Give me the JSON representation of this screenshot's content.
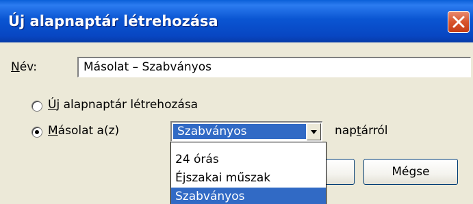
{
  "window": {
    "title": "Új alapnaptár létrehozása",
    "close_label": "close"
  },
  "name_field": {
    "label_accel": "N",
    "label_rest": "év:",
    "value": "Másolat – Szabványos"
  },
  "options": {
    "new_base": {
      "accel": "Ú",
      "rest": "j alapnaptár létrehozása",
      "selected": false
    },
    "copy_from": {
      "accel": "M",
      "rest": "ásolat a(z)",
      "selected": true
    }
  },
  "combo": {
    "selected_value": "Szabványos",
    "suffix_pre": "nap",
    "suffix_accel": "t",
    "suffix_post": "árról",
    "items": [
      "24 órás",
      "Éjszakai műszak",
      "Szabványos"
    ]
  },
  "buttons": {
    "cancel": "Mégse"
  },
  "colors": {
    "title_bar": "#0a55d2",
    "selection": "#316ac5",
    "dialog_bg": "#ece9d8",
    "close_button": "#d8552d"
  }
}
